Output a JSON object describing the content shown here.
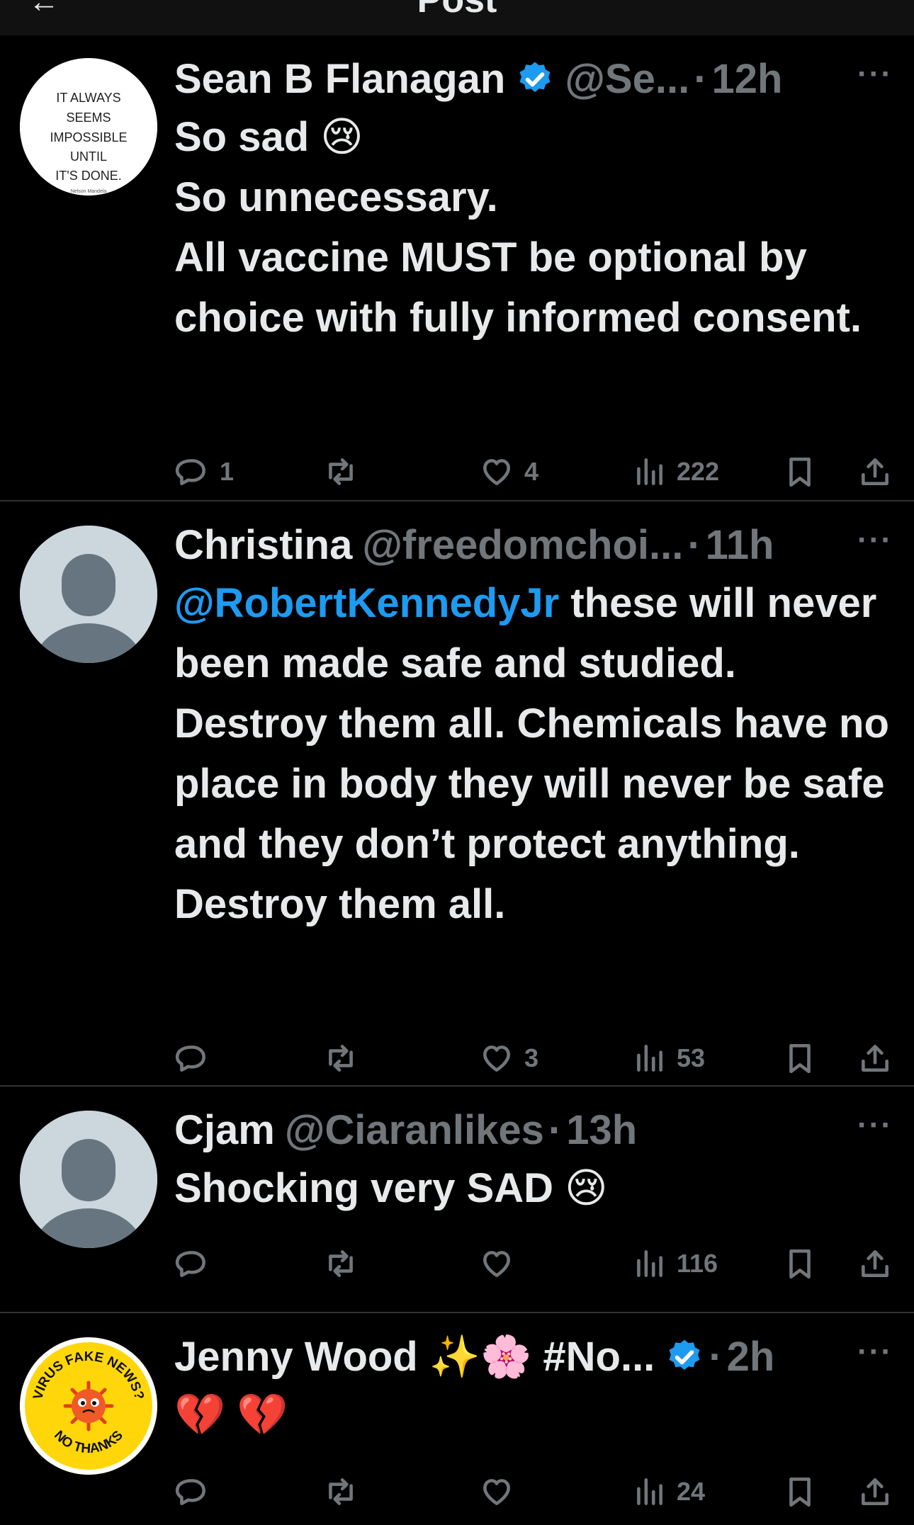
{
  "header": {
    "title": "Post",
    "back_icon": "back-arrow-icon"
  },
  "colors": {
    "background": "#000000",
    "text": "#e7e9ea",
    "muted": "#71767b",
    "link": "#1d9bf0",
    "verified": "#1d9bf0",
    "divider": "#2f3336"
  },
  "posts": [
    {
      "name": "Sean B Flanagan",
      "verified": true,
      "handle": "@Se...",
      "time": "12h",
      "avatar": "quote-image-avatar",
      "avatar_text": "IT ALWAYS SEEMS IMPOSSIBLE UNTIL IT'S DONE.",
      "avatar_signature": "Nelson Mandela",
      "text": "So sad 😢\nSo unnecessary.\nAll vaccine MUST be optional by choice with fully informed consent.",
      "mention": "",
      "replies": "1",
      "reposts": "",
      "likes": "4",
      "views": "222"
    },
    {
      "name": "Christina",
      "verified": false,
      "handle": "@freedomchoi...",
      "time": "11h",
      "avatar": "default-avatar",
      "mention": "@RobertKennedyJr",
      "text": " these will never been made safe and studied. Destroy them all. Chemicals have no place in body they will never be safe and they don’t protect anything. Destroy them all.",
      "replies": "",
      "reposts": "",
      "likes": "3",
      "views": "53"
    },
    {
      "name": "Cjam",
      "verified": false,
      "handle": "@Ciaranlikes",
      "time": "13h",
      "avatar": "default-avatar",
      "mention": "",
      "text": "Shocking very SAD 😢",
      "replies": "",
      "reposts": "",
      "likes": "",
      "views": "116"
    },
    {
      "name": "Jenny Wood ✨🌸 #No...",
      "verified": true,
      "handle": "",
      "time": "2h",
      "avatar": "virus-sticker-avatar",
      "avatar_text_top": "VIRUS FAKE NEWS?",
      "avatar_text_bottom": "NO THANKS",
      "mention": "",
      "text": "💔 💔",
      "replies": "",
      "reposts": "",
      "likes": "",
      "views": "24"
    }
  ]
}
